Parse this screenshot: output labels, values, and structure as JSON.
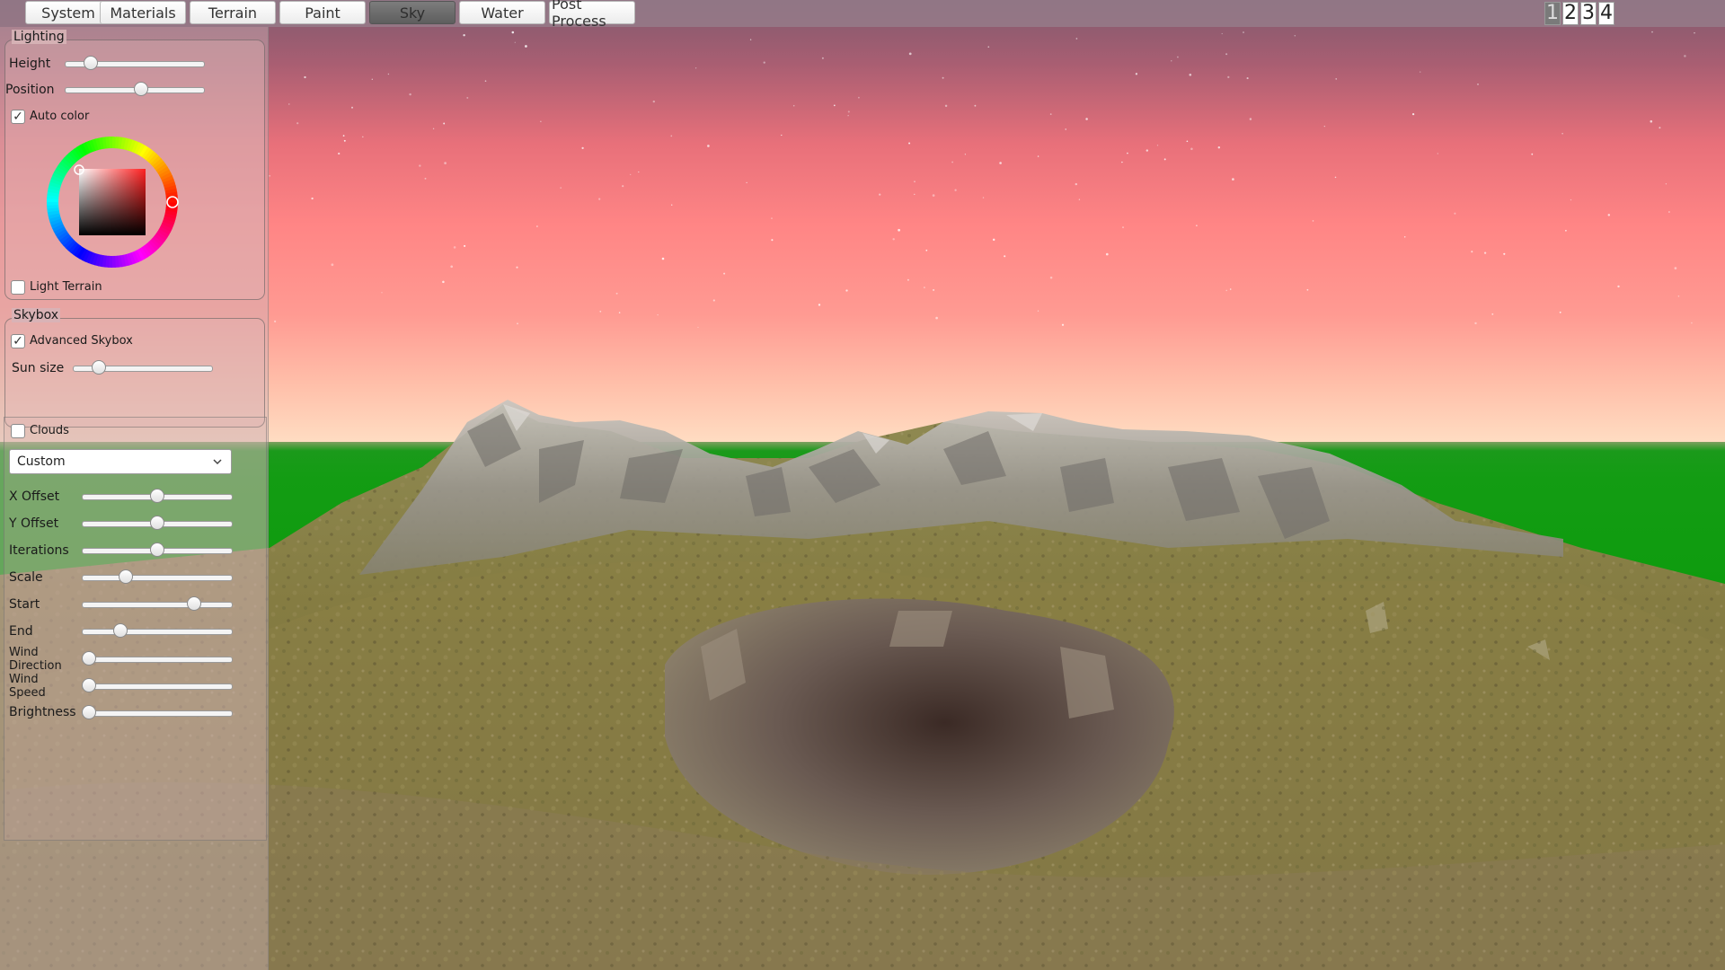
{
  "tabs": [
    {
      "label": "System",
      "active": false
    },
    {
      "label": "Materials",
      "active": false
    },
    {
      "label": "Terrain",
      "active": false
    },
    {
      "label": "Paint",
      "active": false
    },
    {
      "label": "Sky",
      "active": true
    },
    {
      "label": "Water",
      "active": false
    },
    {
      "label": "Post Process",
      "active": false
    }
  ],
  "camera_views": [
    "1",
    "2",
    "3",
    "4"
  ],
  "camera_view_active": "1",
  "lighting": {
    "title": "Lighting",
    "height_label": "Height",
    "height_value": 0.15,
    "position_label": "Position",
    "position_value": 0.55,
    "auto_color_label": "Auto color",
    "auto_color_checked": true,
    "light_terrain_label": "Light Terrain",
    "light_terrain_checked": false,
    "picker_hue_color": "#ff2020"
  },
  "skybox": {
    "title": "Skybox",
    "advanced_label": "Advanced Skybox",
    "advanced_checked": true,
    "sun_size_label": "Sun size",
    "sun_size_value": 0.15
  },
  "clouds": {
    "clouds_label": "Clouds",
    "clouds_checked": false,
    "preset": "Custom",
    "sliders": [
      {
        "label": "X Offset",
        "value": 0.5
      },
      {
        "label": "Y Offset",
        "value": 0.5
      },
      {
        "label": "Iterations",
        "value": 0.5
      },
      {
        "label": "Scale",
        "value": 0.27
      },
      {
        "label": "Start",
        "value": 0.77
      },
      {
        "label": "End",
        "value": 0.23
      },
      {
        "label": "Wind Direction",
        "value": 0.0
      },
      {
        "label": "Wind Speed",
        "value": 0.0
      },
      {
        "label": "Brightness",
        "value": 0.0
      }
    ]
  },
  "colors": {
    "sky_top": "#7f5a6e",
    "sky_mid": "#ff8585",
    "horizon": "#ffe0c5",
    "ground_plane": "#0a9b0a",
    "active_tab": "#6b6b6b"
  }
}
